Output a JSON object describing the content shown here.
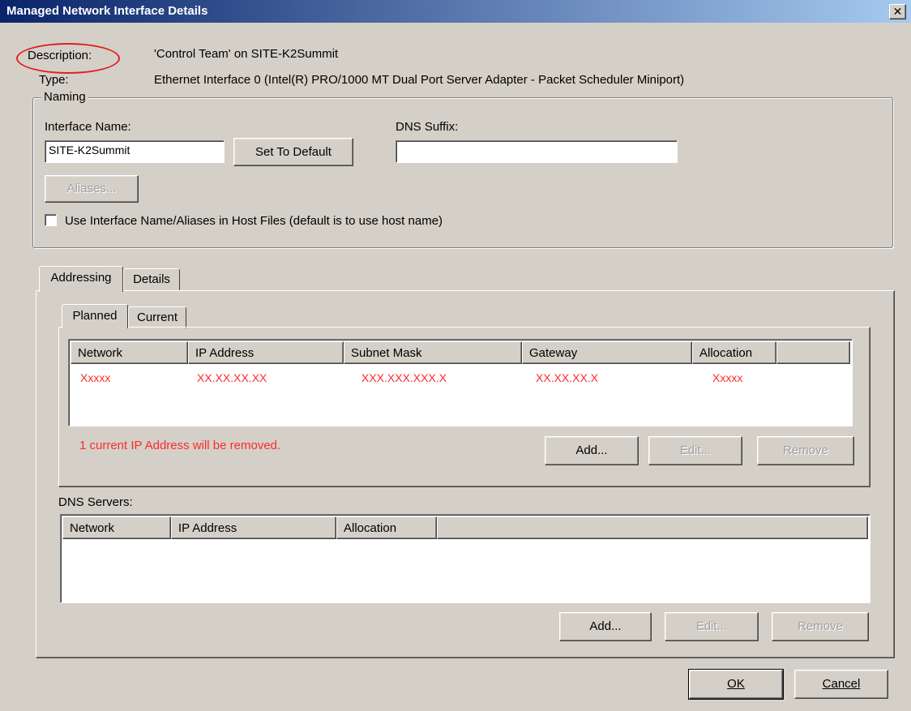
{
  "window": {
    "title": "Managed Network Interface Details",
    "close_glyph": "✕"
  },
  "info": {
    "description_label": "Description:",
    "description_value": "'Control Team' on SITE-K2Summit",
    "type_label": "Type:",
    "type_value": "Ethernet Interface 0 (Intel(R) PRO/1000 MT Dual Port Server Adapter - Packet Scheduler Miniport)"
  },
  "naming": {
    "legend": "Naming",
    "interface_name_label": "Interface Name:",
    "interface_name_value": "SITE-K2Summit",
    "set_default_label": "Set To Default",
    "dns_suffix_label": "DNS Suffix:",
    "dns_suffix_value": "",
    "aliases_label": "Aliases...",
    "use_names_label": "Use Interface Name/Aliases in Host Files (default is to use host name)",
    "use_names_checked": false
  },
  "tabs": {
    "outer": [
      {
        "label": "Addressing"
      },
      {
        "label": "Details"
      }
    ],
    "inner": [
      {
        "label": "Planned"
      },
      {
        "label": "Current"
      }
    ]
  },
  "ip_table": {
    "columns": [
      "Network",
      "IP Address",
      "Subnet Mask",
      "Gateway",
      "Allocation"
    ],
    "rows": [
      [
        "Xxxxx",
        "XX.XX.XX.XX",
        "XXX.XXX.XXX.X",
        "XX.XX.XX.X",
        "Xxxxx"
      ]
    ],
    "warning": "1 current IP Address will be removed.",
    "add_label": "Add...",
    "edit_label": "Edit...",
    "remove_label": "Remove"
  },
  "dns": {
    "label": "DNS Servers:",
    "columns": [
      "Network",
      "IP Address",
      "Allocation"
    ],
    "add_label": "Add...",
    "edit_label": "Edit...",
    "remove_label": "Remove"
  },
  "footer": {
    "ok_label": "OK",
    "cancel_label": "Cancel"
  },
  "colors": {
    "title_start": "#0a246a",
    "title_end": "#a6caf0",
    "window_bg": "#d4d0c8",
    "masked_text": "#ff2a2a",
    "highlight_ellipse": "#e02020"
  }
}
